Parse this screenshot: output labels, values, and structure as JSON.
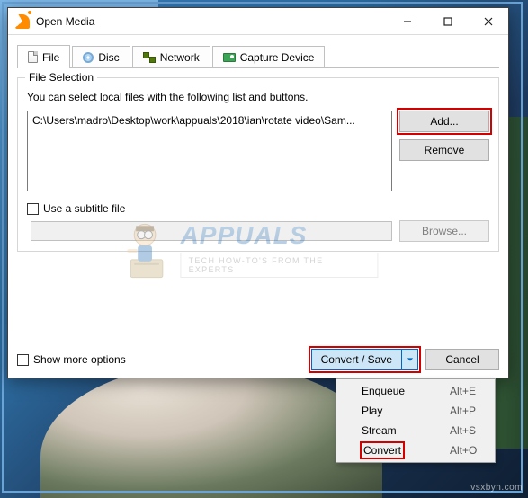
{
  "window": {
    "title": "Open Media"
  },
  "tabs": [
    {
      "label": "File",
      "icon": "file"
    },
    {
      "label": "Disc",
      "icon": "disc"
    },
    {
      "label": "Network",
      "icon": "net"
    },
    {
      "label": "Capture Device",
      "icon": "capture"
    }
  ],
  "group": {
    "legend": "File Selection",
    "hint": "You can select local files with the following list and buttons.",
    "file_item": "C:\\Users\\madro\\Desktop\\work\\appuals\\2018\\ian\\rotate video\\Sam...",
    "add_label": "Add...",
    "remove_label": "Remove",
    "subtitle_chk": "Use a subtitle file",
    "browse_label": "Browse..."
  },
  "bottom": {
    "show_more": "Show more options",
    "convert_save": "Convert / Save",
    "cancel": "Cancel"
  },
  "menu": [
    {
      "label": "Enqueue",
      "accel": "Alt+E"
    },
    {
      "label": "Play",
      "accel": "Alt+P"
    },
    {
      "label": "Stream",
      "accel": "Alt+S"
    },
    {
      "label": "Convert",
      "accel": "Alt+O"
    }
  ],
  "watermark": {
    "brand": "APPUALS",
    "tag": "TECH HOW-TO'S FROM THE EXPERTS",
    "site": "vsxbyn.com"
  }
}
